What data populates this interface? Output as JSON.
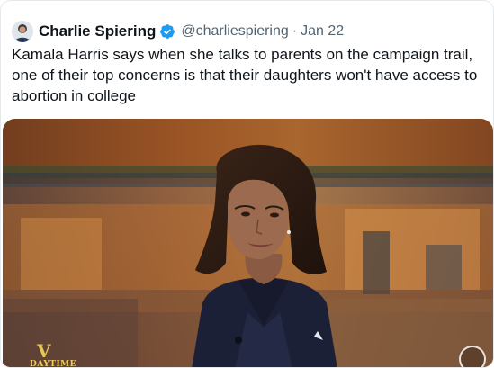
{
  "tweet": {
    "display_name": "Charlie Spiering",
    "handle": "@charliespiering",
    "separator": "·",
    "date": "Jan 22",
    "text": "Kamala Harris says when she talks to parents on the campaign trail, one of their top concerns is that their daughters won't have access to abortion in college"
  },
  "media": {
    "logo": "DAYTIME"
  },
  "icons": {
    "avatar": "avatar",
    "verified": "verified-badge-icon",
    "play": "play-icon"
  },
  "colors": {
    "verified_blue": "#1d9bf0",
    "secondary_text": "#536471",
    "primary_text": "#0f1419"
  }
}
